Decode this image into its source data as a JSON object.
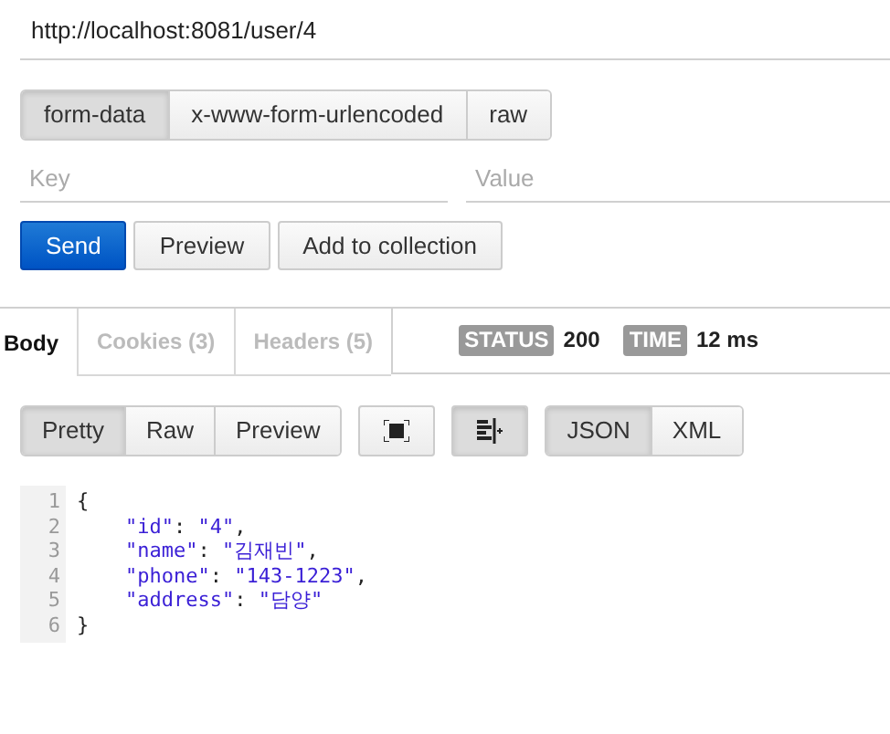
{
  "url": "http://localhost:8081/user/4",
  "body_modes": [
    {
      "label": "form-data",
      "selected": true
    },
    {
      "label": "x-www-form-urlencoded",
      "selected": false
    },
    {
      "label": "raw",
      "selected": false
    }
  ],
  "params": {
    "key_placeholder": "Key",
    "value_placeholder": "Value"
  },
  "actions": [
    "Send",
    "Preview",
    "Add to collection"
  ],
  "response_tabs": [
    {
      "label": "Body",
      "selected": true
    },
    {
      "label": "Cookies (3)",
      "selected": false
    },
    {
      "label": "Headers (5)",
      "selected": false
    }
  ],
  "status": {
    "label": "STATUS",
    "value": "200"
  },
  "time": {
    "label": "TIME",
    "value": "12 ms"
  },
  "view_modes": [
    {
      "label": "Pretty",
      "selected": true
    },
    {
      "label": "Raw",
      "selected": false
    },
    {
      "label": "Preview",
      "selected": false
    }
  ],
  "tools": [
    {
      "kind": "fullscreen",
      "pressed": false
    },
    {
      "kind": "wrap",
      "pressed": true
    }
  ],
  "formats": [
    {
      "label": "JSON",
      "selected": true
    },
    {
      "label": "XML",
      "selected": false
    }
  ],
  "code": [
    {
      "number": "1",
      "text": "{"
    },
    {
      "number": "2",
      "text": "    \"id\": \"4\","
    },
    {
      "number": "3",
      "text": "    \"name\": \"김재빈\","
    },
    {
      "number": "4",
      "text": "    \"phone\": \"143-1223\","
    },
    {
      "number": "5",
      "text": "    \"address\": \"담양\""
    },
    {
      "number": "6",
      "text": "}"
    }
  ]
}
